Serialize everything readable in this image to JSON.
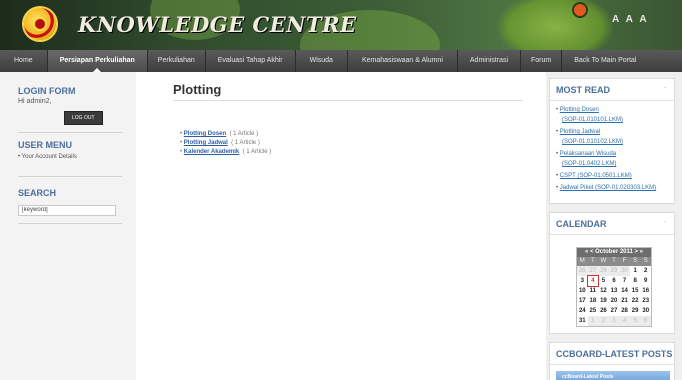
{
  "header": {
    "site_title": "KNOWLEDGE CENTRE",
    "font_size_controls": [
      "A",
      "A",
      "A"
    ]
  },
  "nav": {
    "items": [
      {
        "label": "Home"
      },
      {
        "label": "Persiapan Perkuliahan",
        "active": true
      },
      {
        "label": "Perkuliahan"
      },
      {
        "label": "Evaluasi Tahap Akhir"
      },
      {
        "label": "Wisuda"
      },
      {
        "label": "Kemahasiswaan & Alumni"
      },
      {
        "label": "Administrasi"
      },
      {
        "label": "Forum"
      },
      {
        "label": "Back To Main Portal"
      }
    ]
  },
  "login": {
    "title": "LOGIN FORM",
    "greeting": "Hi admin2,",
    "logout_label": "LOG OUT"
  },
  "user_menu": {
    "title": "USER MENU",
    "items": [
      "Your Account Details"
    ]
  },
  "search": {
    "title": "SEARCH",
    "value": "[keyword]"
  },
  "main": {
    "page_title": "Plotting",
    "categories": [
      {
        "name": "Plotting Dosen",
        "count": "( 1 Article )"
      },
      {
        "name": "Plotting Jadwal",
        "count": "( 1 Article )"
      },
      {
        "name": "Kalender Akademik",
        "count": "( 1 Article )"
      }
    ]
  },
  "most_read": {
    "title": "MOST READ",
    "collapse_label": "-",
    "items": [
      [
        "Plotting Dosen",
        "(SOP-01.010101.LKM)"
      ],
      [
        "Plotting Jadwal",
        "(SOP-01.010102.LKM)"
      ],
      [
        "Pelaksanaan Wisuda",
        "(SOP-01.0402.LKM)"
      ],
      [
        "CSPT (SOP-01.0501.LKM)"
      ],
      [
        "Jadwal Piket (SOP-01.020303.LKM)"
      ]
    ]
  },
  "calendar": {
    "title": "CALENDAR",
    "collapse_label": "-",
    "header": "« <   October 2011   > »",
    "weekdays": [
      "M",
      "T",
      "W",
      "T",
      "F",
      "S",
      "S"
    ],
    "days": [
      {
        "d": "26",
        "muted": true
      },
      {
        "d": "27",
        "muted": true
      },
      {
        "d": "28",
        "muted": true
      },
      {
        "d": "29",
        "muted": true
      },
      {
        "d": "30",
        "muted": true
      },
      {
        "d": "1"
      },
      {
        "d": "2"
      },
      {
        "d": "3"
      },
      {
        "d": "4",
        "today": true
      },
      {
        "d": "5"
      },
      {
        "d": "6"
      },
      {
        "d": "7"
      },
      {
        "d": "8"
      },
      {
        "d": "9"
      },
      {
        "d": "10"
      },
      {
        "d": "11"
      },
      {
        "d": "12"
      },
      {
        "d": "13"
      },
      {
        "d": "14"
      },
      {
        "d": "15"
      },
      {
        "d": "16"
      },
      {
        "d": "17"
      },
      {
        "d": "18"
      },
      {
        "d": "19"
      },
      {
        "d": "20"
      },
      {
        "d": "21"
      },
      {
        "d": "22"
      },
      {
        "d": "23"
      },
      {
        "d": "24"
      },
      {
        "d": "25"
      },
      {
        "d": "26"
      },
      {
        "d": "27"
      },
      {
        "d": "28"
      },
      {
        "d": "29"
      },
      {
        "d": "30"
      },
      {
        "d": "31"
      },
      {
        "d": "1",
        "muted": true
      },
      {
        "d": "2",
        "muted": true
      },
      {
        "d": "3",
        "muted": true
      },
      {
        "d": "4",
        "muted": true
      },
      {
        "d": "5",
        "muted": true
      },
      {
        "d": "6",
        "muted": true
      }
    ]
  },
  "ccboard": {
    "title": "CCBOARD-LATEST POSTS",
    "collapse_label": "-",
    "bar_label": "ccBoard-Latest Posts"
  },
  "colors": {
    "accent_blue": "#4b6f9c",
    "link_blue": "#2d5ea6",
    "nav_bg": "#4a4a4a"
  }
}
